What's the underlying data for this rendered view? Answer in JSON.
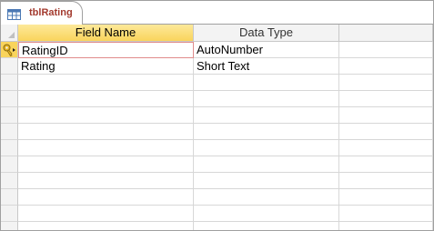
{
  "tab": {
    "label": "tblRating",
    "icon": "table-icon"
  },
  "grid": {
    "columns": [
      "Field Name",
      "Data Type",
      ""
    ],
    "rows": [
      {
        "field_name": "RatingID",
        "data_type": "AutoNumber",
        "primary_key": true
      },
      {
        "field_name": "Rating",
        "data_type": "Short Text",
        "primary_key": false
      }
    ],
    "empty_row_count": 10
  },
  "colors": {
    "header_active": "#f9d45c",
    "tab_label": "#a33a2e",
    "grid_line": "#d7d7d7"
  }
}
